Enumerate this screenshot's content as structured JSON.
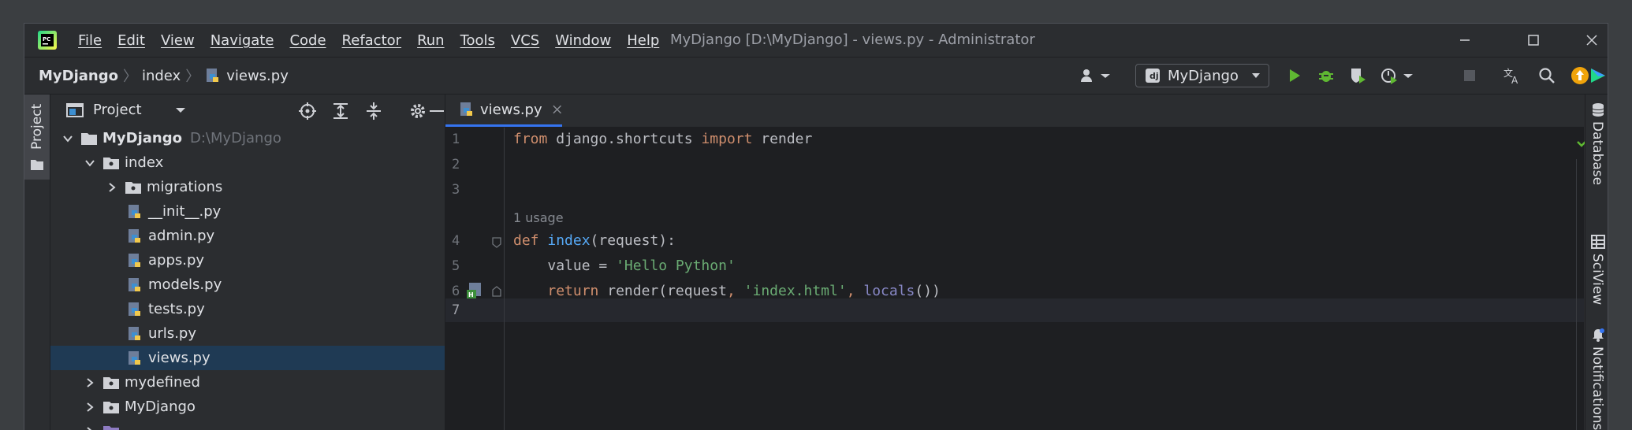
{
  "menu": [
    "File",
    "Edit",
    "View",
    "Navigate",
    "Code",
    "Refactor",
    "Run",
    "Tools",
    "VCS",
    "Window",
    "Help"
  ],
  "window_title": "MyDjango [D:\\MyDjango] - views.py - Administrator",
  "app_logo_text": "PC",
  "breadcrumb": {
    "root": "MyDjango",
    "folder": "index",
    "file": "views.py"
  },
  "run_config": "MyDjango",
  "left_strip": {
    "project_label": "Project"
  },
  "project_panel": {
    "title": "Project",
    "tree": [
      {
        "label": "MyDjango",
        "hint": "D:\\MyDjango"
      },
      {
        "label": "index"
      },
      {
        "label": "migrations"
      },
      {
        "label": "__init__.py"
      },
      {
        "label": "admin.py"
      },
      {
        "label": "apps.py"
      },
      {
        "label": "models.py"
      },
      {
        "label": "tests.py"
      },
      {
        "label": "urls.py"
      },
      {
        "label": "views.py"
      },
      {
        "label": "mydefined"
      },
      {
        "label": "MyDjango"
      }
    ]
  },
  "editor": {
    "tab": "views.py",
    "line_numbers": [
      "1",
      "2",
      "3",
      "4",
      "5",
      "6",
      "7"
    ],
    "usage_hint": "1 usage",
    "code": {
      "l1_kw1": "from",
      "l1_mod": " django.shortcuts ",
      "l1_kw2": "import",
      "l1_name": " render",
      "l4_kw": "def",
      "l4_fn": "index",
      "l4_rest": "(request):",
      "l5_a": "value = ",
      "l5_str": "'Hello Python'",
      "l6_kw": "return",
      "l6_a": " render(request",
      "l6_c1": ", ",
      "l6_str": "'index.html'",
      "l6_c2": ", ",
      "l6_bi": "locals",
      "l6_end": "())"
    }
  },
  "right_strip": [
    "Database",
    "SciView",
    "Notifications"
  ],
  "colors": {
    "accent": "#3574f0",
    "selection": "#1f3a54",
    "run_green": "#5fb832",
    "update_orange": "#f0a30a"
  }
}
